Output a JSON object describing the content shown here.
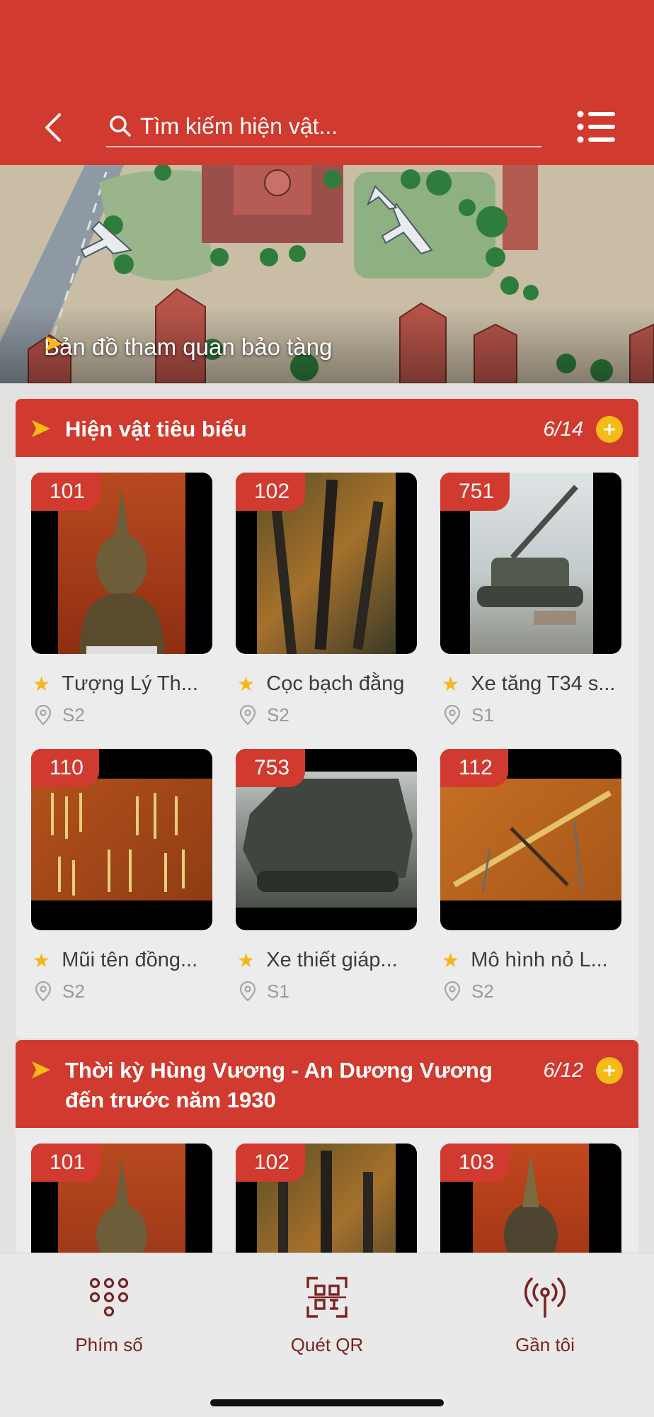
{
  "search": {
    "placeholder": "Tìm kiếm hiện vật..."
  },
  "map_banner": {
    "label": "Bản đồ tham quan bảo tàng"
  },
  "sections": [
    {
      "title": "Hiện vật tiêu biểu",
      "count": "6/14",
      "items": [
        {
          "code": "101",
          "name": "Tượng Lý Th...",
          "location": "S2"
        },
        {
          "code": "102",
          "name": "Cọc bạch đằng",
          "location": "S2"
        },
        {
          "code": "751",
          "name": "Xe tăng T34 s...",
          "location": "S1"
        },
        {
          "code": "110",
          "name": "Mũi tên đồng...",
          "location": "S2"
        },
        {
          "code": "753",
          "name": "Xe thiết giáp...",
          "location": "S1"
        },
        {
          "code": "112",
          "name": "Mô hình nỏ L...",
          "location": "S2"
        }
      ]
    },
    {
      "title": "Thời kỳ Hùng Vương - An Dương Vương đến trước năm 1930",
      "count": "6/12",
      "items": [
        {
          "code": "101"
        },
        {
          "code": "102"
        },
        {
          "code": "103"
        }
      ]
    }
  ],
  "tabbar": {
    "keypad_label": "Phím số",
    "qr_label": "Quét QR",
    "nearby_label": "Gần tôi"
  },
  "colors": {
    "primary": "#d13a2f",
    "accent": "#f6bb16",
    "tab_text": "#7a2222"
  }
}
